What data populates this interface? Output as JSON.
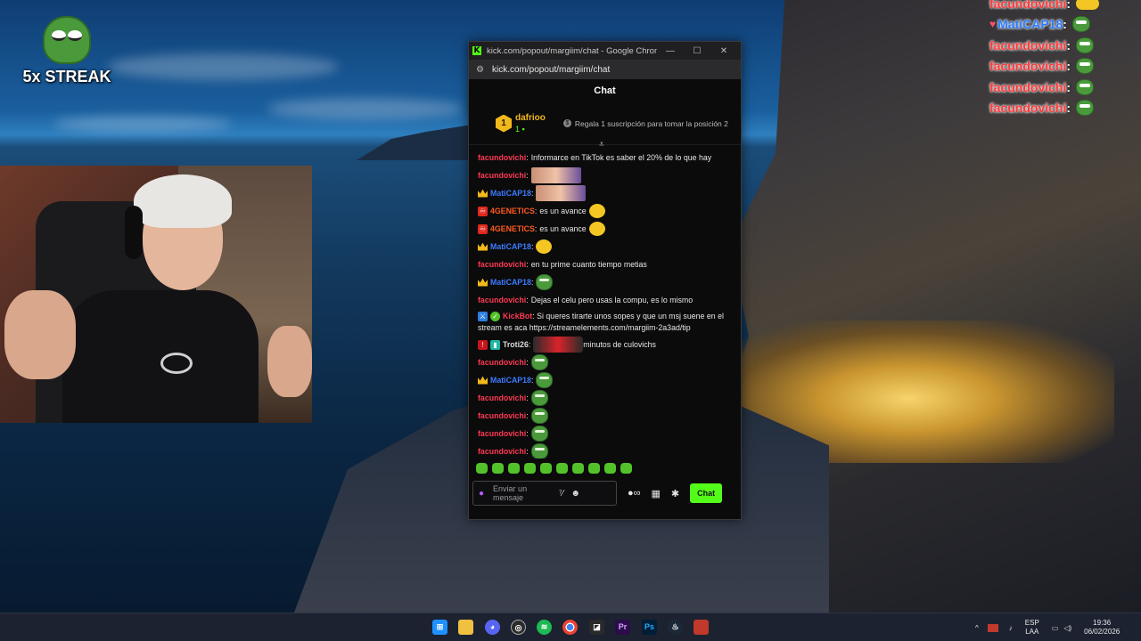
{
  "streak": {
    "label": "5x STREAK"
  },
  "side_chat": [
    {
      "name": "facundovichi",
      "style": "red",
      "heart": false,
      "emote": "coin"
    },
    {
      "name": "MatiCAP18",
      "style": "blue",
      "heart": true,
      "emote": "pepe"
    },
    {
      "name": "facundovichi",
      "style": "red",
      "heart": false,
      "emote": "pepe"
    },
    {
      "name": "facundovichi",
      "style": "red",
      "heart": false,
      "emote": "pepe"
    },
    {
      "name": "facundovichi",
      "style": "red",
      "heart": false,
      "emote": "pepe"
    },
    {
      "name": "facundovichi",
      "style": "red",
      "heart": false,
      "emote": "pepe"
    }
  ],
  "window": {
    "title": "kick.com/popout/margiim/chat - Google Chrome",
    "url": "kick.com/popout/margiim/chat",
    "minimize": "—",
    "maximize": "☐",
    "close": "✕"
  },
  "chat": {
    "header": "Chat",
    "pinned": {
      "rank": "1",
      "gifter": "dafrioo",
      "count": "1",
      "info": "Regala 1 suscripción para tomar la posición 2"
    },
    "messages": [
      {
        "user": "facundovichi",
        "color": "red",
        "badge": "",
        "text": "Informarce en TikTok es saber el 20% de lo que hay",
        "emote": ""
      },
      {
        "user": "facundovichi",
        "color": "red",
        "badge": "",
        "text": "",
        "emote": "img"
      },
      {
        "user": "MatiCAP18",
        "color": "blue",
        "badge": "crown",
        "text": "",
        "emote": "img"
      },
      {
        "user": "4GENETICS",
        "color": "orange",
        "badge": "sq-red",
        "text": "es un avance",
        "emote": "coin"
      },
      {
        "user": "4GENETICS",
        "color": "orange",
        "badge": "sq-red",
        "text": "es un avance",
        "emote": "coin"
      },
      {
        "user": "MatiCAP18",
        "color": "blue",
        "badge": "crown",
        "text": "",
        "emote": "coin"
      },
      {
        "user": "facundovichi",
        "color": "red",
        "badge": "",
        "text": "en tu prime cuanto tiempo metias",
        "emote": ""
      },
      {
        "user": "MatiCAP18",
        "color": "blue",
        "badge": "crown",
        "text": "",
        "emote": "pepe"
      },
      {
        "user": "facundovichi",
        "color": "red",
        "badge": "",
        "text": "Dejas el celu pero usas la compu, es lo mismo",
        "emote": ""
      }
    ],
    "bot_message": {
      "user": "KickBot",
      "text": "Si queres tirarte unos sopes y que un msj suene en el stream es aca https://streamelements.com/margiim-2a3ad/tip"
    },
    "messages_after": [
      {
        "user": "Troti26",
        "color": "white",
        "badge": "sq-red2",
        "text": "minutos de culovichs",
        "emote": "car"
      },
      {
        "user": "facundovichi",
        "color": "red",
        "badge": "",
        "text": "",
        "emote": "pepe"
      },
      {
        "user": "MatiCAP18",
        "color": "blue",
        "badge": "crown",
        "text": "",
        "emote": "pepe"
      },
      {
        "user": "facundovichi",
        "color": "red",
        "badge": "",
        "text": "",
        "emote": "pepe"
      },
      {
        "user": "facundovichi",
        "color": "red",
        "badge": "",
        "text": "",
        "emote": "pepe"
      },
      {
        "user": "facundovichi",
        "color": "red",
        "badge": "",
        "text": "",
        "emote": "pepe"
      },
      {
        "user": "facundovichi",
        "color": "red",
        "badge": "",
        "text": "",
        "emote": "pepe"
      }
    ],
    "input_placeholder": "Enviar un mensaje",
    "send_label": "Chat"
  },
  "taskbar": {
    "language": "ESP",
    "layout": "LAA",
    "time": "19:36",
    "date": "06/02/2026"
  },
  "colors": {
    "kick_green": "#53fc18",
    "user_red": "#ff3a52",
    "user_blue": "#3d7bff"
  }
}
